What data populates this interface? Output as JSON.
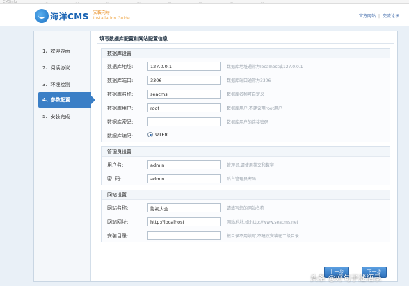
{
  "browser_bar": {
    "items": [
      "CMSinfo",
      "...",
      "...",
      "...",
      "...",
      "...",
      "...",
      "...",
      "..."
    ]
  },
  "header": {
    "logo_text": "海洋CMS",
    "logo_sub_line1": "安装向导",
    "logo_sub_line2": "Installation Guide",
    "links": [
      "官方网站",
      "交流论坛"
    ]
  },
  "steps": [
    {
      "label": "1、欢迎界面"
    },
    {
      "label": "2、阅读协议"
    },
    {
      "label": "3、环境检测"
    },
    {
      "label": "4、参数配置"
    },
    {
      "label": "5、安装完成"
    }
  ],
  "active_step": 3,
  "content_title": "填写数据库配置和网站配置信息",
  "db_section": {
    "title": "数据库设置",
    "rows": [
      {
        "label": "数据库地址:",
        "value": "127.0.0.1",
        "hint": "数据库地址通常为localhost或127.0.0.1"
      },
      {
        "label": "数据库端口:",
        "value": "3306",
        "hint": "数据库端口通常为3306"
      },
      {
        "label": "数据库名称:",
        "value": "seacms",
        "hint": "数据库名称可自定义"
      },
      {
        "label": "数据库用户:",
        "value": "root",
        "hint": "数据库用户,不建议用root用户"
      },
      {
        "label": "数据库密码:",
        "value": "",
        "hint": "数据库用户的连接密码"
      }
    ],
    "encoding_label": "数据库编码:",
    "encoding_value": "UTF8"
  },
  "admin_section": {
    "title": "管理员设置",
    "rows": [
      {
        "label": "用户名:",
        "value": "admin",
        "hint": "管理员,请使用英文和数字"
      },
      {
        "label": "密  码:",
        "value": "admin",
        "hint": "后台管理员密码"
      }
    ]
  },
  "site_section": {
    "title": "网站设置",
    "rows": [
      {
        "label": "网站名称:",
        "value": "影视大全",
        "hint": "请填写您的网站名称"
      },
      {
        "label": "网站网址:",
        "value": "http://localhost",
        "hint": "网站地址,如:http://www.seacms.net"
      },
      {
        "label": "安装目录:",
        "value": "",
        "hint": "根目录不用填写,不建议安装在二级目录"
      }
    ]
  },
  "buttons": {
    "prev": "上一步",
    "next": "下一步"
  },
  "watermark": "头条 @好句子迷语录",
  "colors": {
    "accent": "#3b7fc6",
    "background": "#e9f0f7"
  }
}
